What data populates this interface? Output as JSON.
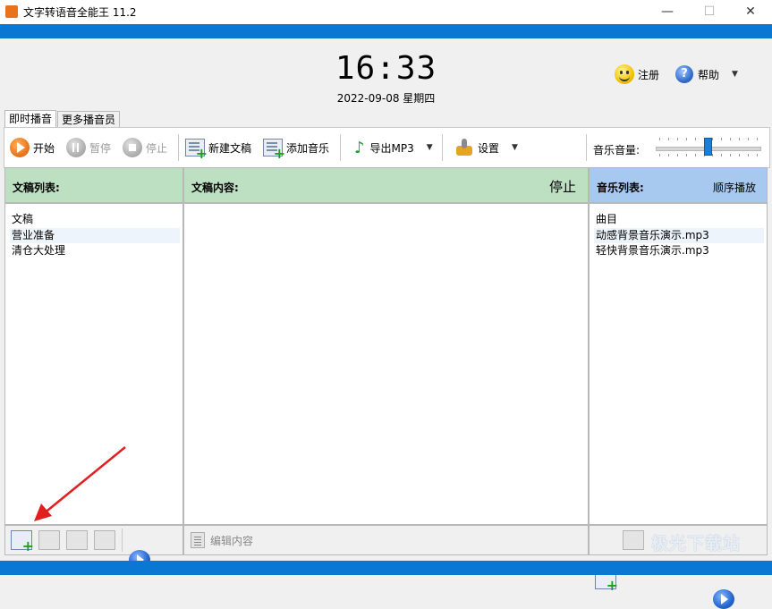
{
  "window": {
    "title": "文字转语音全能王 11.2",
    "controls": [
      "—",
      "☐",
      "✕"
    ]
  },
  "header": {
    "time": "16:33",
    "date": "2022-09-08 星期四",
    "register_label": "注册",
    "help_label": "帮助"
  },
  "tabs": [
    {
      "label": "即时播音",
      "active": true
    },
    {
      "label": "更多播音员",
      "active": false
    }
  ],
  "toolbar": {
    "start_label": "开始",
    "pause_label": "暂停",
    "stop_label": "停止",
    "new_doc_label": "新建文稿",
    "add_music_label": "添加音乐",
    "export_label": "导出MP3",
    "settings_label": "设置",
    "volume_label": "音乐音量:",
    "volume_level": 0.5
  },
  "left_panel": {
    "title": "文稿列表:",
    "column_header": "文稿",
    "items": [
      "营业准备",
      "清仓大处理"
    ]
  },
  "middle_panel": {
    "title": "文稿内容:",
    "status": "停止",
    "edit_label": "编辑内容"
  },
  "right_panel": {
    "title": "音乐列表:",
    "mode": "顺序播放",
    "column_header": "曲目",
    "items": [
      "动感背景音乐演示.mp3",
      "轻快背景音乐演示.mp3"
    ]
  },
  "watermark": "极光下载站",
  "colors": {
    "accent_blue": "#0a78d2",
    "panel_green": "#bde0c3",
    "panel_blue": "#a7c9f0",
    "play_orange": "#e8731c"
  }
}
